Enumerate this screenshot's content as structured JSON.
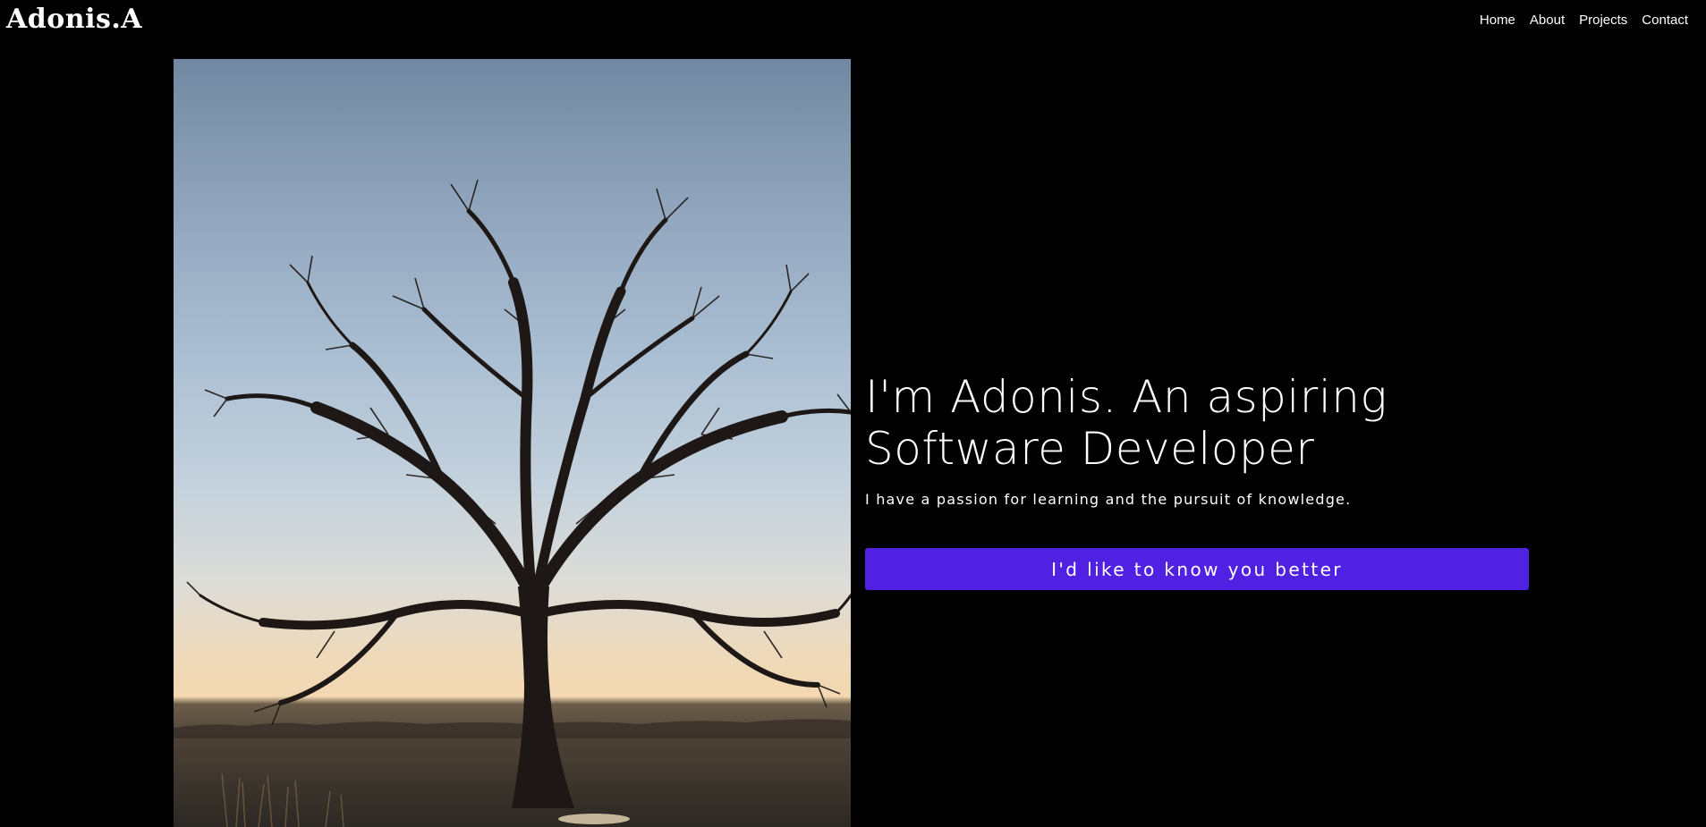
{
  "navbar": {
    "brand": "Adonis.A",
    "links": [
      {
        "label": "Home"
      },
      {
        "label": "About"
      },
      {
        "label": "Projects"
      },
      {
        "label": "Contact"
      }
    ]
  },
  "hero": {
    "title": "I'm Adonis. An aspiring Software Developer",
    "subtitle": "I have a passion for learning and the pursuit of knowledge.",
    "cta_label": "I'd like to know you better"
  },
  "colors": {
    "background": "#000000",
    "accent": "#5021e2",
    "text": "#ffffff"
  }
}
